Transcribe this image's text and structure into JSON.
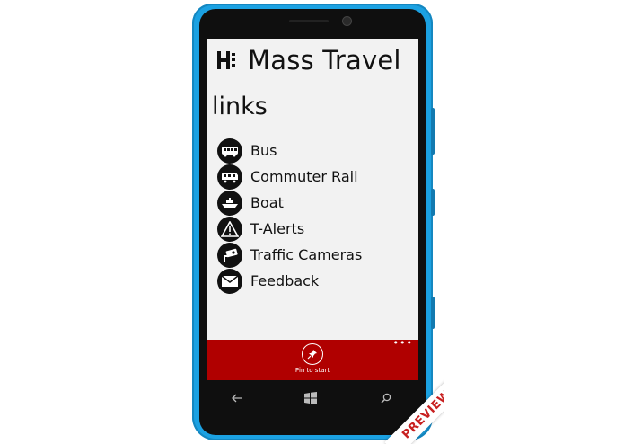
{
  "app": {
    "title": "Mass Travel"
  },
  "page": {
    "title": "links"
  },
  "links": [
    {
      "label": "Bus",
      "icon": "bus-icon"
    },
    {
      "label": "Commuter Rail",
      "icon": "train-icon"
    },
    {
      "label": "Boat",
      "icon": "boat-icon"
    },
    {
      "label": "T-Alerts",
      "icon": "alert-icon"
    },
    {
      "label": "Traffic Cameras",
      "icon": "camera-icon"
    },
    {
      "label": "Feedback",
      "icon": "mail-icon"
    }
  ],
  "appbar": {
    "pin_label": "Pin to start",
    "more": "•••"
  },
  "badge": {
    "text": "PREVIEW"
  },
  "colors": {
    "phone": "#1ba1e2",
    "appbar": "#b00000",
    "screen": "#f2f2f2",
    "ribbon_text": "#c82020"
  }
}
